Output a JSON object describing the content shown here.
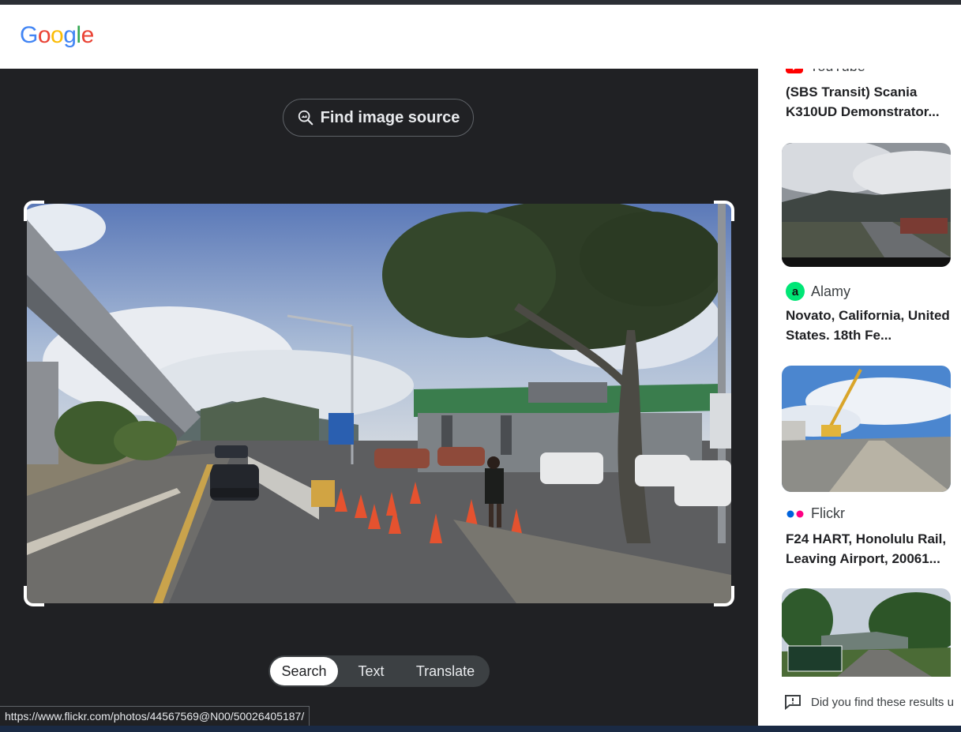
{
  "logo": {
    "letters": [
      "G",
      "o",
      "o",
      "g",
      "l",
      "e"
    ],
    "colors": [
      "#4285F4",
      "#EA4335",
      "#FBBC05",
      "#4285F4",
      "#34A853",
      "#EA4335"
    ]
  },
  "lens": {
    "find_source_label": "Find image source",
    "find_source_icon": "image-search-icon",
    "tabs": [
      "Search",
      "Text",
      "Translate"
    ],
    "active_tab": "Search"
  },
  "status_url": "https://www.flickr.com/photos/44567569@N00/50026405187/",
  "results": [
    {
      "source": "YouTube",
      "source_icon": "youtube-icon",
      "title": "(SBS Transit) Scania K310UD Demonstrator..."
    },
    {
      "source": "Alamy",
      "source_icon": "alamy-icon",
      "title": "Novato, California, United States. 18th Fe..."
    },
    {
      "source": "Flickr",
      "source_icon": "flickr-icon",
      "title": "F24 HART, Honolulu Rail, Leaving Airport, 20061..."
    }
  ],
  "feedback_text": "Did you find these results u",
  "colors": {
    "dark_bg": "#202124",
    "youtube": "#FF0000",
    "alamy": "#00E676",
    "flickr_blue": "#0063DC",
    "flickr_pink": "#FF0084"
  }
}
